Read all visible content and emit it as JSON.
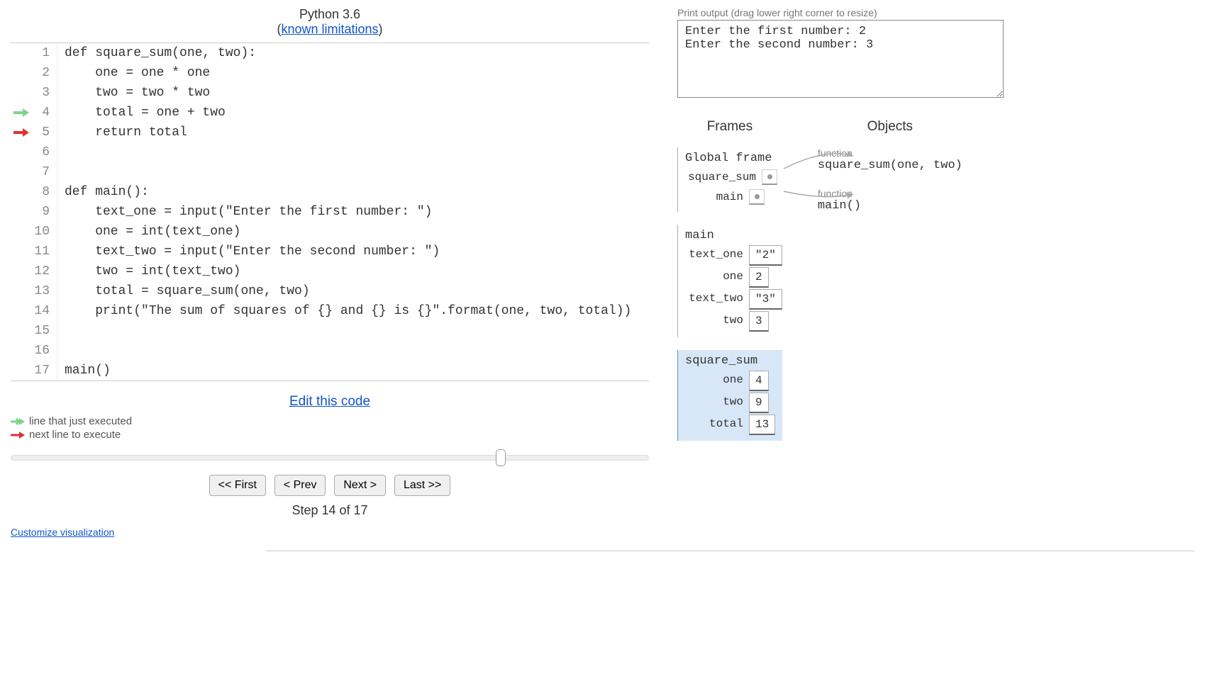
{
  "header": {
    "version": "Python 3.6",
    "limitations_label": "known limitations"
  },
  "code": {
    "lines": [
      "def square_sum(one, two):",
      "    one = one * one",
      "    two = two * two",
      "    total = one + two",
      "    return total",
      "",
      "",
      "def main():",
      "    text_one = input(\"Enter the first number: \")",
      "    one = int(text_one)",
      "    text_two = input(\"Enter the second number: \")",
      "    two = int(text_two)",
      "    total = square_sum(one, two)",
      "    print(\"The sum of squares of {} and {} is {}\".format(one, two, total))",
      "",
      "",
      "main()"
    ],
    "just_executed_line": 4,
    "next_line": 5
  },
  "edit_link": "Edit this code",
  "legend": {
    "just_executed": "line that just executed",
    "next_line": "next line to execute"
  },
  "slider": {
    "percent": 76
  },
  "nav": {
    "first": "<< First",
    "prev": "< Prev",
    "next": "Next >",
    "last": "Last >>"
  },
  "step": {
    "current": 14,
    "total": 17,
    "label": "Step 14 of 17"
  },
  "customize_label": "Customize visualization",
  "output": {
    "hint": "Print output (drag lower right corner to resize)",
    "text": "Enter the first number: 2\nEnter the second number: 3"
  },
  "frames_header": "Frames",
  "objects_header": "Objects",
  "frames": [
    {
      "name": "Global frame",
      "highlighted": false,
      "vars": [
        {
          "name": "square_sum",
          "pointer": true
        },
        {
          "name": "main",
          "pointer": true
        }
      ]
    },
    {
      "name": "main",
      "highlighted": false,
      "vars": [
        {
          "name": "text_one",
          "value": "\"2\""
        },
        {
          "name": "one",
          "value": "2"
        },
        {
          "name": "text_two",
          "value": "\"3\""
        },
        {
          "name": "two",
          "value": "3"
        }
      ]
    },
    {
      "name": "square_sum",
      "highlighted": true,
      "vars": [
        {
          "name": "one",
          "value": "4"
        },
        {
          "name": "two",
          "value": "9"
        },
        {
          "name": "total",
          "value": "13"
        }
      ]
    }
  ],
  "objects": [
    {
      "type": "function",
      "repr": "square_sum(one, two)"
    },
    {
      "type": "function",
      "repr": "main()"
    }
  ]
}
